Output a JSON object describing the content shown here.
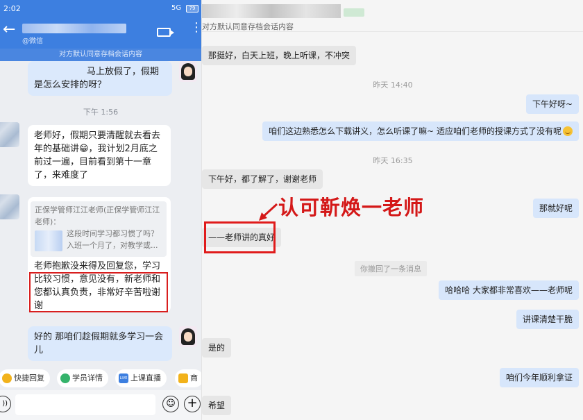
{
  "phone": {
    "status_time": "2:02",
    "network": "5G",
    "battery": "79",
    "contact_subtitle": "@微信",
    "notice": "对方默认同意存档会话内容",
    "messages": [
      {
        "text": "马上放假了，假期是怎么安排的呀？"
      },
      {
        "time": "下午 1:56"
      },
      {
        "text": "老师好，假期只要清醒就去看去年的基础讲😁，我计划2月底之前过一遍，目前看到第十一章了，来难度了"
      },
      {
        "quote": "正保学管师江江老师(正保学管师江江老师)：",
        "quote_body": "这段时间学习都习惯了吗？入班一个月了，对教学或...",
        "text": "老师抱歉没来得及回复您，学习比较习惯，意见没有，新老师和您都认真负责，非常好辛苦啦谢谢"
      },
      {
        "text": "好的 那咱们趁假期就多学习一会儿"
      }
    ],
    "toolbar": [
      "快捷回复",
      "学员详情",
      "上课直播",
      "商"
    ],
    "toolbar_live_tag": "LIVE"
  },
  "desktop": {
    "notice": "对方默认同意存档会话内容",
    "messages": [
      {
        "text": "那挺好，白天上班，晚上听课，不冲突"
      },
      {
        "time": "昨天 14:40"
      },
      {
        "text": "下午好呀~"
      },
      {
        "text": "咱们这边熟悉怎么下载讲义，怎么听课了嘛~ 适应咱们老师的授课方式了没有呢"
      },
      {
        "time": "昨天 16:35"
      },
      {
        "text": "下午好，都了解了，谢谢老师"
      },
      {
        "text": "那就好呢"
      },
      {
        "text": "——老师讲的真好"
      },
      {
        "system": "你撤回了一条消息"
      },
      {
        "text": "哈哈哈 大家都非常喜欢——老师呢"
      },
      {
        "text": "讲课清楚干脆"
      },
      {
        "text": "是的"
      },
      {
        "text": "咱们今年顺利拿证"
      },
      {
        "text": "希望"
      }
    ],
    "annotation": "认可靳焕一老师"
  },
  "colors": {
    "phone_blue": "#3d7fe0",
    "highlight_red": "#d81e1e",
    "out_bubble": "#d7e6fb"
  }
}
